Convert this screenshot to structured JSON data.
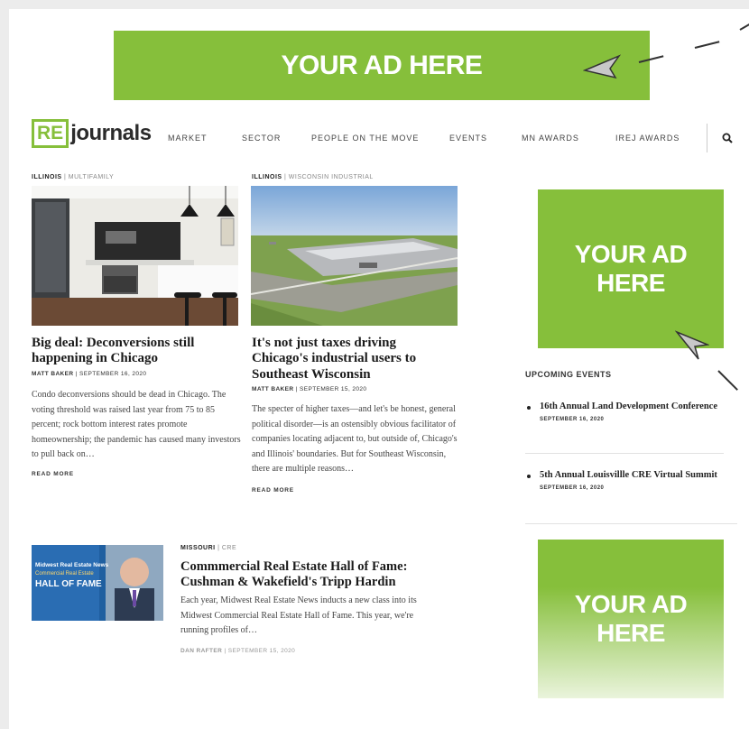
{
  "ads": {
    "top": "YOUR AD HERE",
    "side1": "YOUR AD HERE",
    "side2": "YOUR AD HERE"
  },
  "colors": {
    "accent": "#86bf3b",
    "text": "#1a1a1a"
  },
  "header": {
    "logo_box": "RE",
    "logo_text": "journals",
    "nav": [
      "MARKET",
      "SECTOR",
      "PEOPLE ON THE MOVE",
      "EVENTS",
      "MN AWARDS",
      "IREJ AWARDS"
    ],
    "search_icon": "search-icon"
  },
  "articles": [
    {
      "kicker": "ILLINOIS",
      "subkicker": "MULTIFAMILY",
      "title": "Big deal: Deconversions still happening in Chicago",
      "author": "MATT BAKER",
      "date": "SEPTEMBER 16, 2020",
      "excerpt": "Condo deconversions should be dead in Chicago. The voting threshold was raised last year from 75 to 85 percent; rock bottom interest rates promote homeownership; the pandemic has caused many investors to pull back on…",
      "read_more": "READ MORE"
    },
    {
      "kicker": "ILLINOIS",
      "subkicker": "WISCONSIN  INDUSTRIAL",
      "title": "It's not just taxes driving Chicago's industrial users to Southeast Wisconsin",
      "author": "MATT BAKER",
      "date": "SEPTEMBER 15, 2020",
      "excerpt": "The specter of higher taxes—and let's be honest, general political disorder—is an ostensibly obvious facilitator of companies locating adjacent to, but outside of, Chicago's and Illinois' boundaries. But for Southeast Wisconsin, there are multiple reasons…",
      "read_more": "READ MORE"
    },
    {
      "kicker": "MISSOURI",
      "subkicker": "CRE",
      "title": "Commmercial Real Estate Hall of Fame: Cushman & Wakefield's Tripp Hardin",
      "author": "DAN RAFTER",
      "date": "SEPTEMBER 15, 2020",
      "excerpt": "Each year, Midwest Real Estate News inducts a new class into its Midwest Commercial Real Estate Hall of Fame. This year, we're running profiles of…",
      "thumb_line1": "Midwest Real Estate News",
      "thumb_line2": "Commercial Real Estate",
      "thumb_line3": "HALL OF FAME"
    }
  ],
  "events": {
    "title": "UPCOMING EVENTS",
    "items": [
      {
        "title": "16th Annual Land Development Conference",
        "date": "SEPTEMBER 16, 2020"
      },
      {
        "title": "5th Annual Louisvillle CRE Virtual Summit",
        "date": "SEPTEMBER 16, 2020"
      }
    ]
  }
}
